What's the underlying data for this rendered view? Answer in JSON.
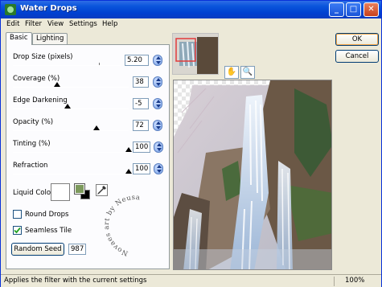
{
  "window": {
    "title": "Water Drops",
    "minimize": "_",
    "maximize": "□",
    "close": "✕"
  },
  "menu": [
    "Edit",
    "Filter",
    "View",
    "Settings",
    "Help"
  ],
  "tabs": [
    "Basic",
    "Lighting"
  ],
  "controls": {
    "drop_size": {
      "label": "Drop Size (pixels)",
      "value": "5.20",
      "level_pct": 88
    },
    "coverage": {
      "label": "Coverage (%)",
      "value": "38",
      "level_pct": 38
    },
    "edge_darkening": {
      "label": "Edge Darkening",
      "value": "-5",
      "level_pct": 47
    },
    "opacity": {
      "label": "Opacity (%)",
      "value": "72",
      "level_pct": 72
    },
    "tinting": {
      "label": "Tinting (%)",
      "value": "100",
      "level_pct": 100
    },
    "refraction": {
      "label": "Refraction",
      "value": "100",
      "level_pct": 100
    }
  },
  "liquid_color": {
    "label": "Liquid Color",
    "color": "#ffffff",
    "fg": "#7d9a5d",
    "bg": "#000000"
  },
  "checkboxes": {
    "round_drops": {
      "label": "Round Drops",
      "checked": false
    },
    "seamless_tile": {
      "label": "Seamless Tile",
      "checked": true
    }
  },
  "random_seed": {
    "button": "Random Seed",
    "value": "987"
  },
  "buttons": {
    "ok": "OK",
    "cancel": "Cancel"
  },
  "tools": {
    "hand": "✋",
    "zoom": "🔍"
  },
  "watermark": "Novaes art by Neusa",
  "status": {
    "text": "Applies the filter with the current settings",
    "zoom": "100%"
  }
}
